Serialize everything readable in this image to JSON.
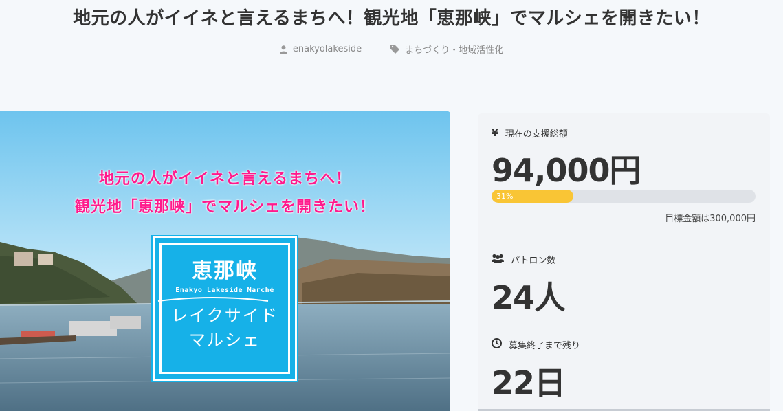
{
  "project": {
    "title": "地元の人がイイネと言えるまちへ！観光地「恵那峡」でマルシェを開きたい！",
    "author": "enakyolakeside",
    "category": "まちづくり・地域活性化"
  },
  "hero_image": {
    "headline_line1": "地元の人がイイネと言えるまちへ！",
    "headline_line2": "観光地「恵那峡」でマルシェを開きたい！",
    "logo_title": "恵那峡",
    "logo_english": "Enakyo Lakeside Marché",
    "logo_sub_line1": "レイクサイド",
    "logo_sub_line2": "マルシェ"
  },
  "stats": {
    "funding_label": "現在の支援総額",
    "funding_value": "94,000円",
    "progress_percent": 31,
    "progress_label": "31%",
    "goal_text": "目標金額は300,000円",
    "patrons_label": "パトロン数",
    "patrons_value": "24人",
    "remaining_label": "募集終了まで残り",
    "remaining_value": "22日"
  },
  "icons": {
    "author": "user-icon",
    "category": "tag-icon",
    "funding": "yen-icon",
    "patrons": "users-icon",
    "remaining": "clock-icon"
  },
  "colors": {
    "progress_fill": "#f9c535",
    "headline_pink": "#ff1a8c",
    "logo_blue": "#16b1e8"
  }
}
